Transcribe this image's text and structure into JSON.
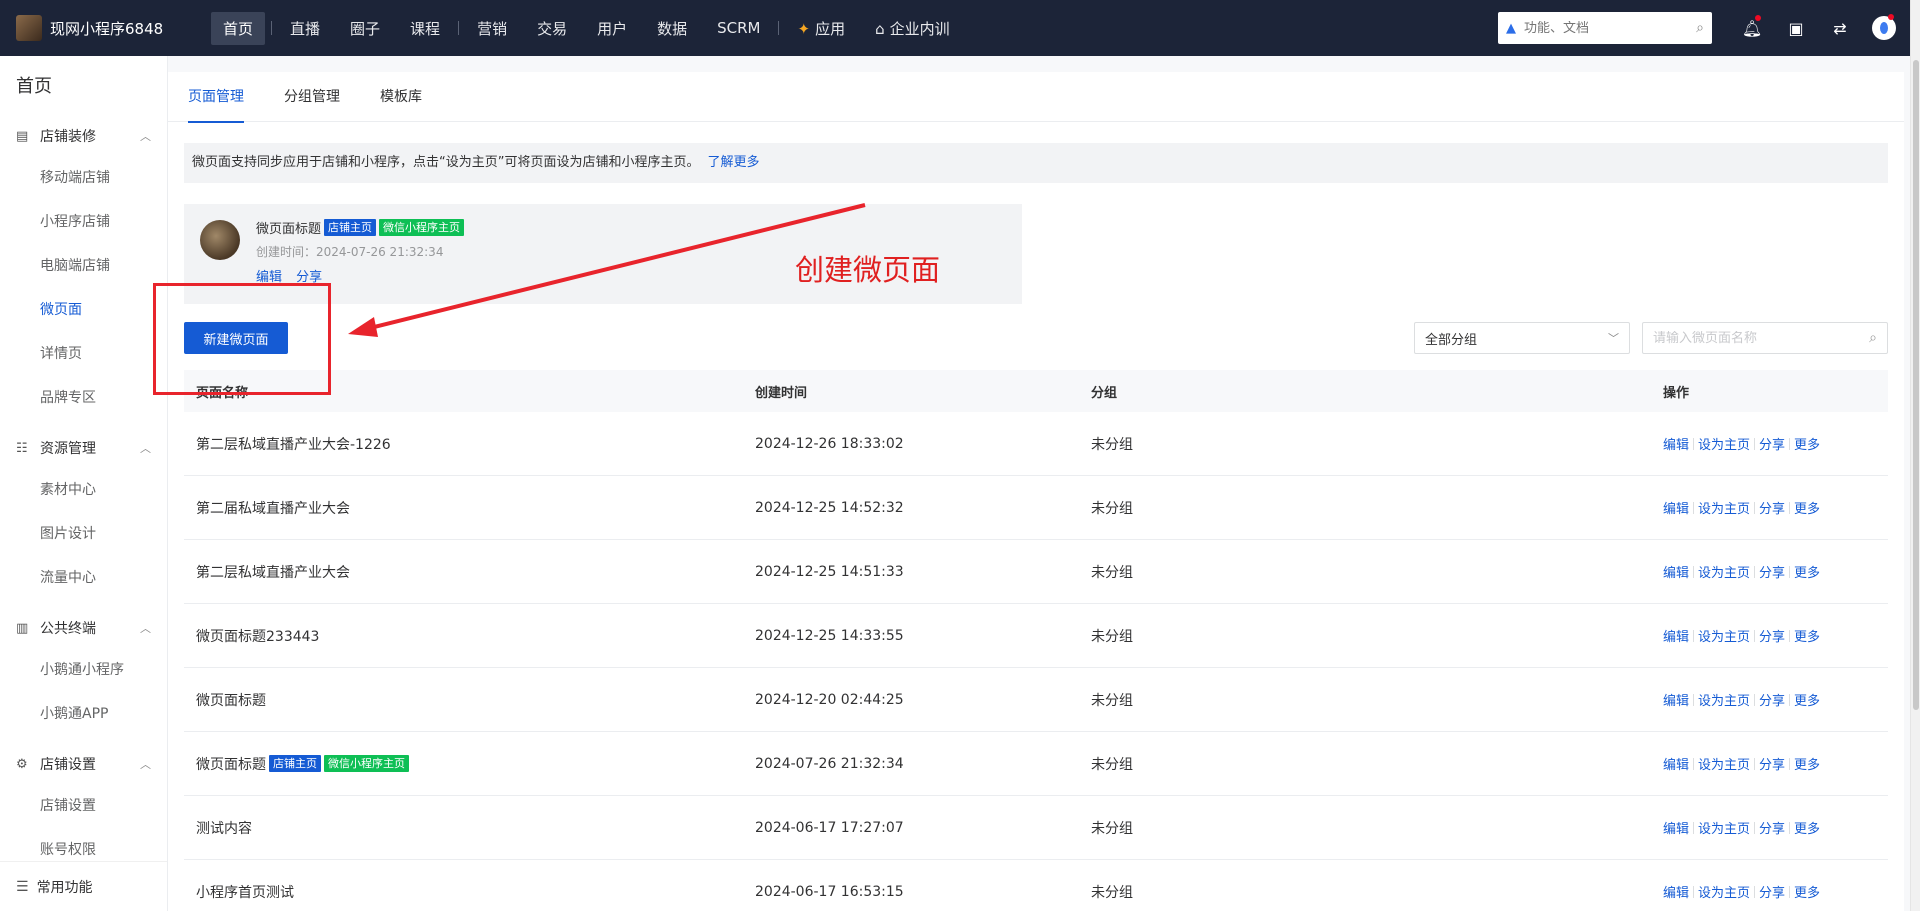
{
  "topbar": {
    "shop_name": "现网小程序6848",
    "nav": [
      {
        "label": "首页",
        "active": true
      },
      {
        "label": "直播"
      },
      {
        "label": "圈子"
      },
      {
        "label": "课程"
      },
      {
        "label": "营销"
      },
      {
        "label": "交易"
      },
      {
        "label": "用户"
      },
      {
        "label": "数据"
      },
      {
        "label": "SCRM"
      },
      {
        "label": "应用"
      },
      {
        "label": "企业内训"
      }
    ],
    "search_placeholder": "功能、文档"
  },
  "sidebar": {
    "title": "首页",
    "groups": [
      {
        "label": "店铺装修",
        "items": [
          "移动端店铺",
          "小程序店铺",
          "电脑端店铺",
          "微页面",
          "详情页",
          "品牌专区"
        ]
      },
      {
        "label": "资源管理",
        "items": [
          "素材中心",
          "图片设计",
          "流量中心"
        ]
      },
      {
        "label": "公共终端",
        "items": [
          "小鹅通小程序",
          "小鹅通APP"
        ]
      },
      {
        "label": "店铺设置",
        "items": [
          "店铺设置",
          "账号权限"
        ]
      }
    ],
    "active_item": "微页面",
    "bottom": "常用功能"
  },
  "tabs": [
    "页面管理",
    "分组管理",
    "模板库"
  ],
  "notice": {
    "text": "微页面支持同步应用于店铺和小程序，点击“设为主页”可将页面设为店铺和小程序主页。",
    "link": "了解更多"
  },
  "preview": {
    "title": "微页面标题",
    "badge_shop": "店铺主页",
    "badge_wechat": "微信小程序主页",
    "created": "创建时间：2024-07-26 21:32:34",
    "edit": "编辑",
    "share": "分享"
  },
  "annotation": "创建微页面",
  "toolbar": {
    "new_button": "新建微页面",
    "group_select": "全部分组",
    "search_placeholder": "请输入微页面名称"
  },
  "table": {
    "headers": [
      "页面名称",
      "创建时间",
      "分组",
      "操作"
    ],
    "ops": [
      "编辑",
      "设为主页",
      "分享",
      "更多"
    ],
    "rows": [
      {
        "name": "第二层私域直播产业大会-1226",
        "time": "2024-12-26 18:33:02",
        "group": "未分组",
        "badges": []
      },
      {
        "name": "第二届私域直播产业大会",
        "time": "2024-12-25 14:52:32",
        "group": "未分组",
        "badges": []
      },
      {
        "name": "第二层私域直播产业大会",
        "time": "2024-12-25 14:51:33",
        "group": "未分组",
        "badges": []
      },
      {
        "name": "微页面标题233443",
        "time": "2024-12-25 14:33:55",
        "group": "未分组",
        "badges": []
      },
      {
        "name": "微页面标题",
        "time": "2024-12-20 02:44:25",
        "group": "未分组",
        "badges": []
      },
      {
        "name": "微页面标题",
        "time": "2024-07-26 21:32:34",
        "group": "未分组",
        "badges": [
          "店铺主页",
          "微信小程序主页"
        ]
      },
      {
        "name": "测试内容",
        "time": "2024-06-17 17:27:07",
        "group": "未分组",
        "badges": []
      },
      {
        "name": "小程序首页测试",
        "time": "2024-06-17 16:53:15",
        "group": "未分组",
        "badges": []
      }
    ]
  },
  "colors": {
    "primary": "#155bd4",
    "topbar": "#1c2438",
    "badge_green": "#0ebf55",
    "annotation_red": "#e02020"
  }
}
